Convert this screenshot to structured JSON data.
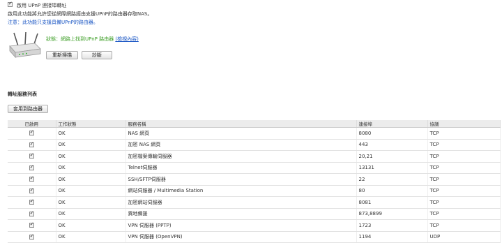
{
  "upnp": {
    "enable_label": "啟用 UPnP 連接埠轉址",
    "description": "啟用此功能將允許您從網際網路經由支援UPnP的路由器存取NAS。",
    "note": "注意：此功能只支援具備UPnP的路由器。"
  },
  "router": {
    "icon": "router-icon",
    "status_prefix": "狀態：",
    "status_text": "網路上找到UPnP 路由器",
    "details_link": "(檢視內容)",
    "rescan_button": "重新掃描",
    "diagnose_button": "診斷"
  },
  "forwarding": {
    "section_title": "轉址服務列表",
    "apply_button": "套用到路由器",
    "columns": [
      "已啟用",
      "工作狀態",
      "服務名稱",
      "連接埠",
      "協議"
    ],
    "rows": [
      {
        "status": "OK",
        "service": "NAS 網頁",
        "port": "8080",
        "protocol": "TCP"
      },
      {
        "status": "OK",
        "service": "加密 NAS 網頁",
        "port": "443",
        "protocol": "TCP"
      },
      {
        "status": "OK",
        "service": "加密檔案傳輸伺服器",
        "port": "20,21",
        "protocol": "TCP"
      },
      {
        "status": "OK",
        "service": "Telnet伺服器",
        "port": "13131",
        "protocol": "TCP"
      },
      {
        "status": "OK",
        "service": "SSH/SFTP伺服器",
        "port": "22",
        "protocol": "TCP"
      },
      {
        "status": "OK",
        "service": "網站伺服器 / Multimedia Station",
        "port": "80",
        "protocol": "TCP"
      },
      {
        "status": "OK",
        "service": "加密網站伺服器",
        "port": "8081",
        "protocol": "TCP"
      },
      {
        "status": "OK",
        "service": "異地備援",
        "port": "873,8899",
        "protocol": "TCP"
      },
      {
        "status": "OK",
        "service": "VPN 伺服器 (PPTP)",
        "port": "1723",
        "protocol": "TCP"
      },
      {
        "status": "OK",
        "service": "VPN 伺服器 (OpenVPN)",
        "port": "1194",
        "protocol": "UDP"
      }
    ]
  }
}
